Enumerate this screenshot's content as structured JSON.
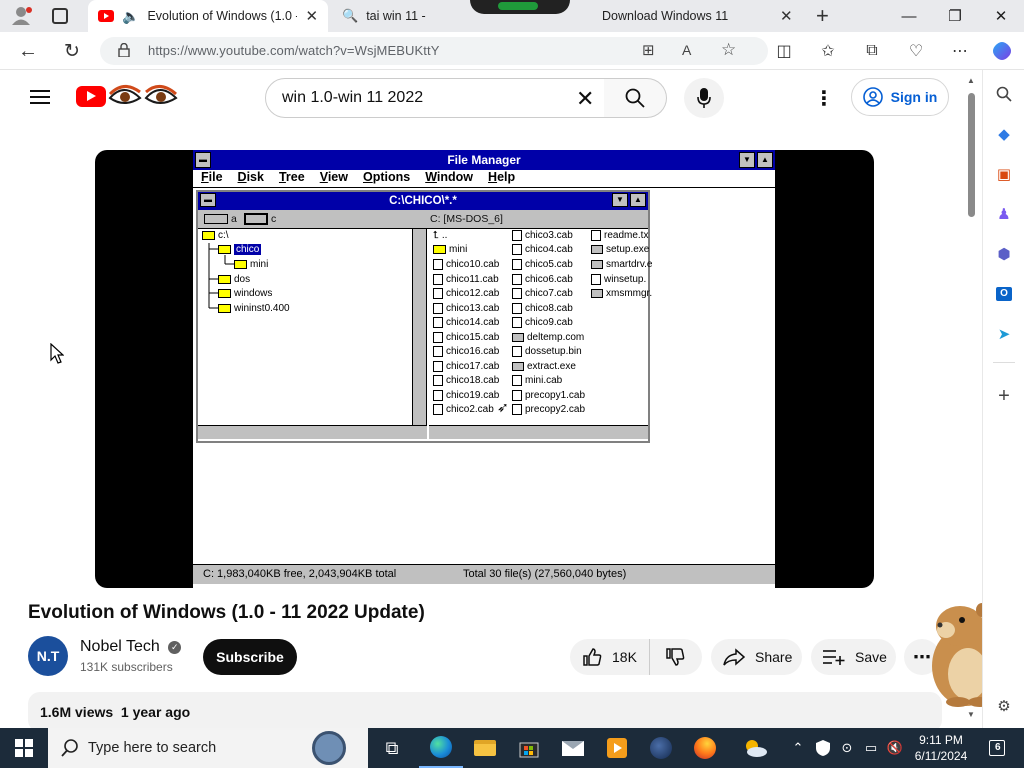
{
  "browser": {
    "tabs": [
      {
        "title": "Evolution of Windows (1.0 -",
        "active": true
      },
      {
        "title": "tai win 11 - ",
        "active": false
      },
      {
        "title": "Download Windows 11",
        "active": false
      }
    ],
    "url": "https://www.youtube.com/watch?v=WsjMEBUKttY",
    "new_tab": "+",
    "minimize": "—",
    "restore": "❐",
    "close": "✕"
  },
  "youtube": {
    "search_query": "win 1.0-win 11 2022",
    "sign_in": "Sign in",
    "video_title": "Evolution of Windows (1.0 - 11 2022 Update)",
    "channel_name": "Nobel Tech",
    "channel_initials": "N.T",
    "subscribers": "131K subscribers",
    "subscribe_label": "Subscribe",
    "like_count": "18K",
    "share_label": "Share",
    "save_label": "Save",
    "views_line": "1.6M views  1 year ago"
  },
  "file_manager": {
    "title": "File Manager",
    "menus": [
      "File",
      "Disk",
      "Tree",
      "View",
      "Options",
      "Window",
      "Help"
    ],
    "child_title": "C:\\CHICO\\*.*",
    "drive_a": "a",
    "drive_c": "c",
    "volume_label": "C: [MS-DOS_6]",
    "tree": [
      {
        "label": "c:\\",
        "depth": 0,
        "selected": false
      },
      {
        "label": "chico",
        "depth": 1,
        "selected": true
      },
      {
        "label": "mini",
        "depth": 2,
        "selected": false
      },
      {
        "label": "dos",
        "depth": 1,
        "selected": false
      },
      {
        "label": "windows",
        "depth": 1,
        "selected": false
      },
      {
        "label": "wininst0.400",
        "depth": 1,
        "selected": false
      }
    ],
    "files_col1": [
      "..",
      "mini",
      "chico10.cab",
      "chico11.cab",
      "chico12.cab",
      "chico13.cab",
      "chico14.cab",
      "chico15.cab",
      "chico16.cab",
      "chico17.cab",
      "chico18.cab",
      "chico19.cab",
      "chico2.cab"
    ],
    "files_col2": [
      "chico3.cab",
      "chico4.cab",
      "chico5.cab",
      "chico6.cab",
      "chico7.cab",
      "chico8.cab",
      "chico9.cab",
      "deltemp.com",
      "dossetup.bin",
      "extract.exe",
      "mini.cab",
      "precopy1.cab",
      "precopy2.cab"
    ],
    "files_col3": [
      "readme.tx",
      "setup.exe",
      "smartdrv.e",
      "winsetup.",
      "xmsmmgr."
    ],
    "status_free": "C: 1,983,040KB free,  2,043,904KB total",
    "status_total": "Total 30 file(s) (27,560,040 bytes)"
  },
  "taskbar": {
    "search_placeholder": "Type here to search",
    "time": "9:11 PM",
    "date": "6/11/2024",
    "notifications": "6"
  }
}
